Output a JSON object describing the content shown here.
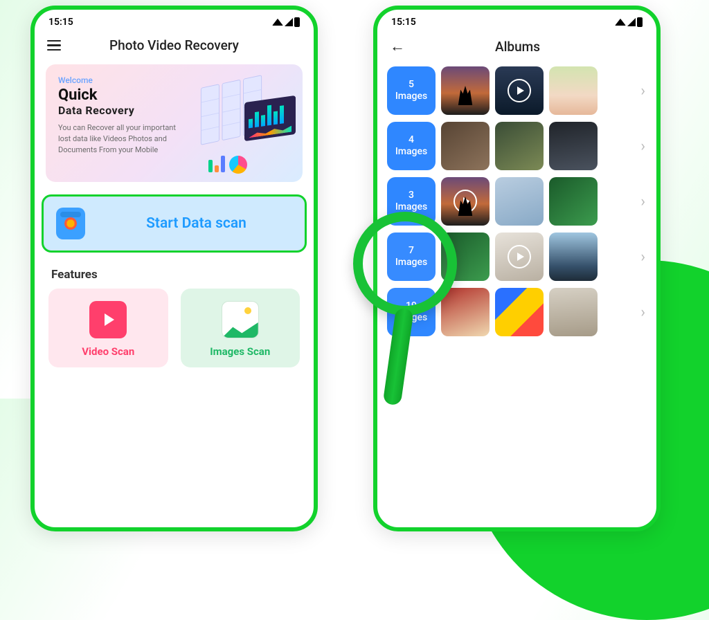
{
  "status": {
    "time": "15:15"
  },
  "phone1": {
    "title": "Photo Video Recovery",
    "hero": {
      "welcome": "Welcome",
      "h1": "Quick",
      "h2": "Data  Recovery",
      "desc": "You can Recover all your important lost data like Videos Photos and Documents From your Mobile"
    },
    "scan_button": "Start Data scan",
    "features_title": "Features",
    "features": {
      "video": "Video Scan",
      "images": "Images Scan"
    }
  },
  "phone2": {
    "title": "Albums",
    "rows": [
      {
        "count": "5",
        "label": "Images"
      },
      {
        "count": "4",
        "label": "Images"
      },
      {
        "count": "3",
        "label": "Images"
      },
      {
        "count": "7",
        "label": "Images"
      },
      {
        "count": "19",
        "label": "Images"
      }
    ]
  }
}
